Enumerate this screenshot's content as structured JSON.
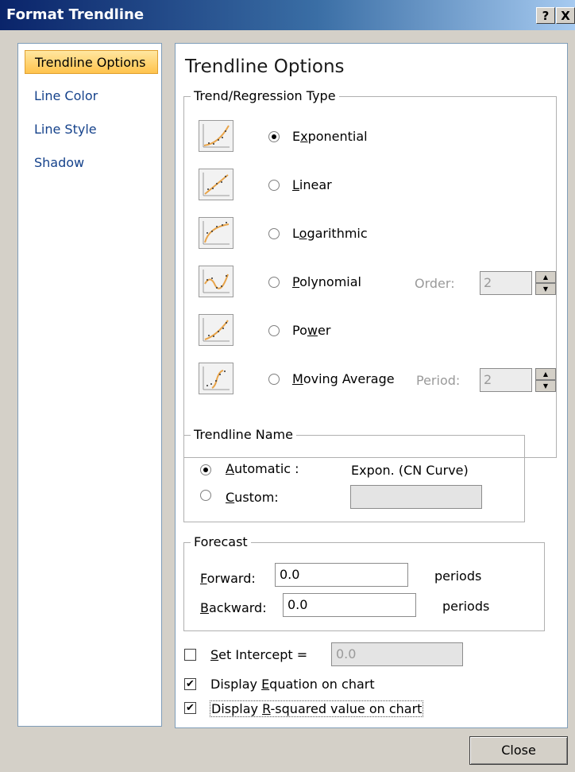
{
  "window": {
    "title": "Format Trendline",
    "help_label": "?",
    "close_label": "X"
  },
  "sidebar": {
    "items": [
      {
        "label": "Trendline Options",
        "selected": true
      },
      {
        "label": "Line Color"
      },
      {
        "label": "Line Style"
      },
      {
        "label": "Shadow"
      }
    ]
  },
  "main": {
    "heading": "Trendline Options",
    "type_group": {
      "label": "Trend/Regression Type",
      "options": [
        {
          "label": "Exponential",
          "underline": "x",
          "selected": true
        },
        {
          "label": "Linear",
          "underline": "L"
        },
        {
          "label": "Logarithmic",
          "underline": "o"
        },
        {
          "label": "Polynomial",
          "underline": "P"
        },
        {
          "label": "Power",
          "underline": "w"
        },
        {
          "label": "Moving Average",
          "underline": "M"
        }
      ],
      "order": {
        "label": "Order:",
        "value": "2"
      },
      "period": {
        "label": "Period:",
        "value": "2"
      }
    },
    "name_group": {
      "label": "Trendline Name",
      "automatic": {
        "label": "Automatic :",
        "selected": true,
        "value": "Expon. (CN Curve)"
      },
      "custom": {
        "label": "Custom:",
        "value": ""
      }
    },
    "forecast_group": {
      "label": "Forecast",
      "forward": {
        "label": "Forward:",
        "value": "0.0",
        "unit": "periods"
      },
      "backward": {
        "label": "Backward:",
        "value": "0.0",
        "unit": "periods"
      }
    },
    "set_intercept": {
      "label": "Set Intercept =",
      "checked": false,
      "value": "0.0"
    },
    "display_equation": {
      "label": "Display Equation on chart",
      "checked": true
    },
    "display_rsquared": {
      "label": "Display R-squared value on chart",
      "checked": true
    }
  },
  "footer": {
    "close_label": "Close"
  },
  "colors": {
    "titlebar": "#0a246a",
    "accent_orange": "#e8a44a",
    "link_blue": "#15428b"
  }
}
